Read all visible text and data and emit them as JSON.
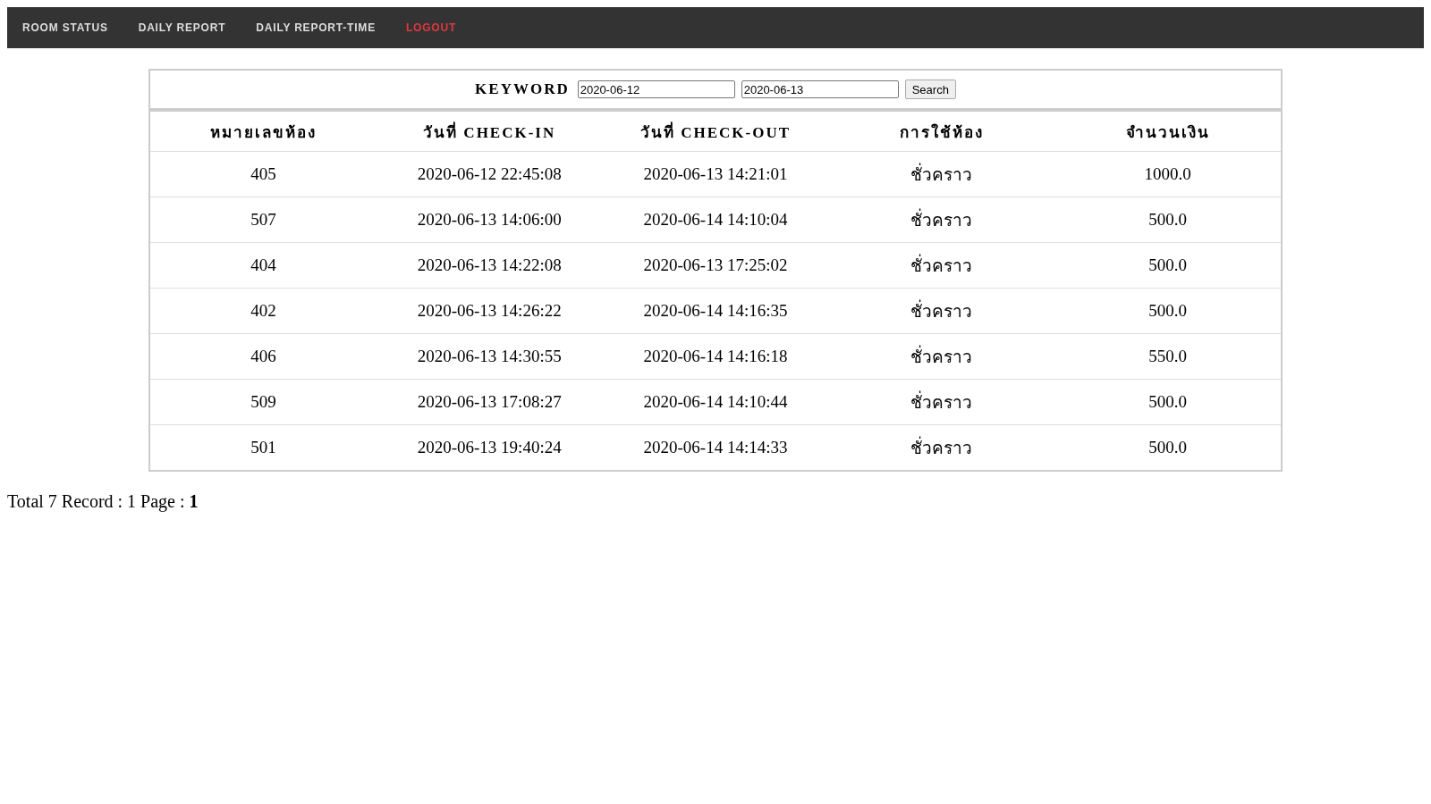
{
  "nav": [
    {
      "label": "ROOM STATUS",
      "kind": "link"
    },
    {
      "label": "DAILY REPORT",
      "kind": "link"
    },
    {
      "label": "DAILY REPORT-TIME",
      "kind": "link"
    },
    {
      "label": "LOGOUT",
      "kind": "logout"
    }
  ],
  "search": {
    "label": "KEYWORD",
    "from": "2020-06-12",
    "to": "2020-06-13",
    "button": "Search"
  },
  "table": {
    "columns": [
      "หมายเลขห้อง",
      "วันที่ CHECK-IN",
      "วันที่ CHECK-OUT",
      "การใช้ห้อง",
      "จำนวนเงิน"
    ],
    "rows": [
      [
        "405",
        "2020-06-12 22:45:08",
        "2020-06-13 14:21:01",
        "ชั่วคราว",
        "1000.0"
      ],
      [
        "507",
        "2020-06-13 14:06:00",
        "2020-06-14 14:10:04",
        "ชั่วคราว",
        "500.0"
      ],
      [
        "404",
        "2020-06-13 14:22:08",
        "2020-06-13 17:25:02",
        "ชั่วคราว",
        "500.0"
      ],
      [
        "402",
        "2020-06-13 14:26:22",
        "2020-06-14 14:16:35",
        "ชั่วคราว",
        "500.0"
      ],
      [
        "406",
        "2020-06-13 14:30:55",
        "2020-06-14 14:16:18",
        "ชั่วคราว",
        "550.0"
      ],
      [
        "509",
        "2020-06-13 17:08:27",
        "2020-06-14 14:10:44",
        "ชั่วคราว",
        "500.0"
      ],
      [
        "501",
        "2020-06-13 19:40:24",
        "2020-06-14 14:14:33",
        "ชั่วคราว",
        "500.0"
      ]
    ]
  },
  "footer": "Total 7 Record : 1 Page : **1**"
}
